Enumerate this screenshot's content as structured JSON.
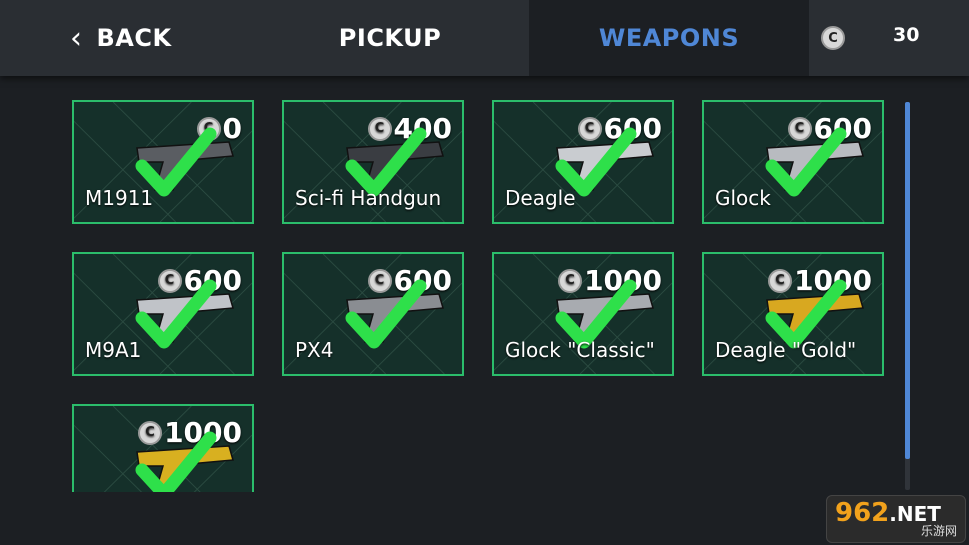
{
  "header": {
    "back_label": "BACK",
    "pickup_label": "PICKUP",
    "weapons_label": "WEAPONS",
    "currency_amount": "30",
    "active_tab": "weapons",
    "accent_color": "#4f87d6"
  },
  "weapons": [
    {
      "name": "M1911",
      "price": "0",
      "owned": true,
      "gun_color": "#5a5d62"
    },
    {
      "name": "Sci-fi Handgun",
      "price": "400",
      "owned": true,
      "gun_color": "#3a3d42"
    },
    {
      "name": "Deagle",
      "price": "600",
      "owned": true,
      "gun_color": "#c9ccd0"
    },
    {
      "name": "Glock",
      "price": "600",
      "owned": true,
      "gun_color": "#b8bbc0"
    },
    {
      "name": "M9A1",
      "price": "600",
      "owned": true,
      "gun_color": "#c0c3c8"
    },
    {
      "name": "PX4",
      "price": "600",
      "owned": true,
      "gun_color": "#8a8d92"
    },
    {
      "name": "Glock \"Classic\"",
      "price": "1000",
      "owned": true,
      "gun_color": "#a8abb0"
    },
    {
      "name": "Deagle \"Gold\"",
      "price": "1000",
      "owned": true,
      "gun_color": "#d8a820"
    },
    {
      "name": "",
      "price": "1000",
      "owned": true,
      "gun_color": "#d8b020"
    }
  ],
  "scroll": {
    "fraction": 0.92
  },
  "watermark": {
    "main": "962",
    "net": ".NET",
    "sub": "乐游网"
  },
  "colors": {
    "card_border": "#2bbd6b",
    "check": "#2ee04a",
    "card_bg": "#15302a"
  },
  "icons": {
    "back": "chevron-left-icon",
    "coin": "coin-icon",
    "owned": "checkmark-icon"
  }
}
